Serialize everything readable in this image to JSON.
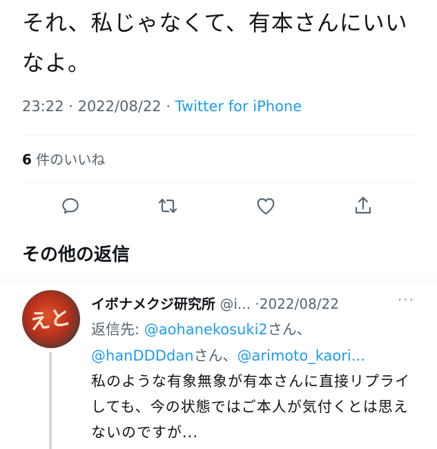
{
  "tweet": {
    "text": "それ、私じゃなくて、有本さんにいいなよ。",
    "time": "23:22",
    "date": "2022/08/22",
    "source": "Twitter for iPhone",
    "likes_count": "6",
    "likes_label": "件のいいね"
  },
  "actions": {
    "reply_icon": "reply-icon",
    "retweet_icon": "retweet-icon",
    "like_icon": "heart-icon",
    "share_icon": "share-icon"
  },
  "section_title": "その他の返信",
  "reply": {
    "avatar_text": "えと",
    "name": "イボナメクジ研究所",
    "handle": "@i...",
    "date": "2022/08/22",
    "more": "···",
    "replying_prefix": "返信先: ",
    "mention1": "@aohanekosuki2",
    "suffix1": "さん、",
    "mention2": "@hanDDDdan",
    "suffix2": "さん、",
    "mention3": "@arimoto_kaori",
    "suffix3": "...",
    "body": "私のような有象無象が有本さんに直接リプライしても、今の状態ではご本人が気付くとは思えないのですが..."
  },
  "colors": {
    "accent": "#1d9bf0",
    "muted": "#536471",
    "text": "#0f1419",
    "divider": "#eff3f4"
  }
}
